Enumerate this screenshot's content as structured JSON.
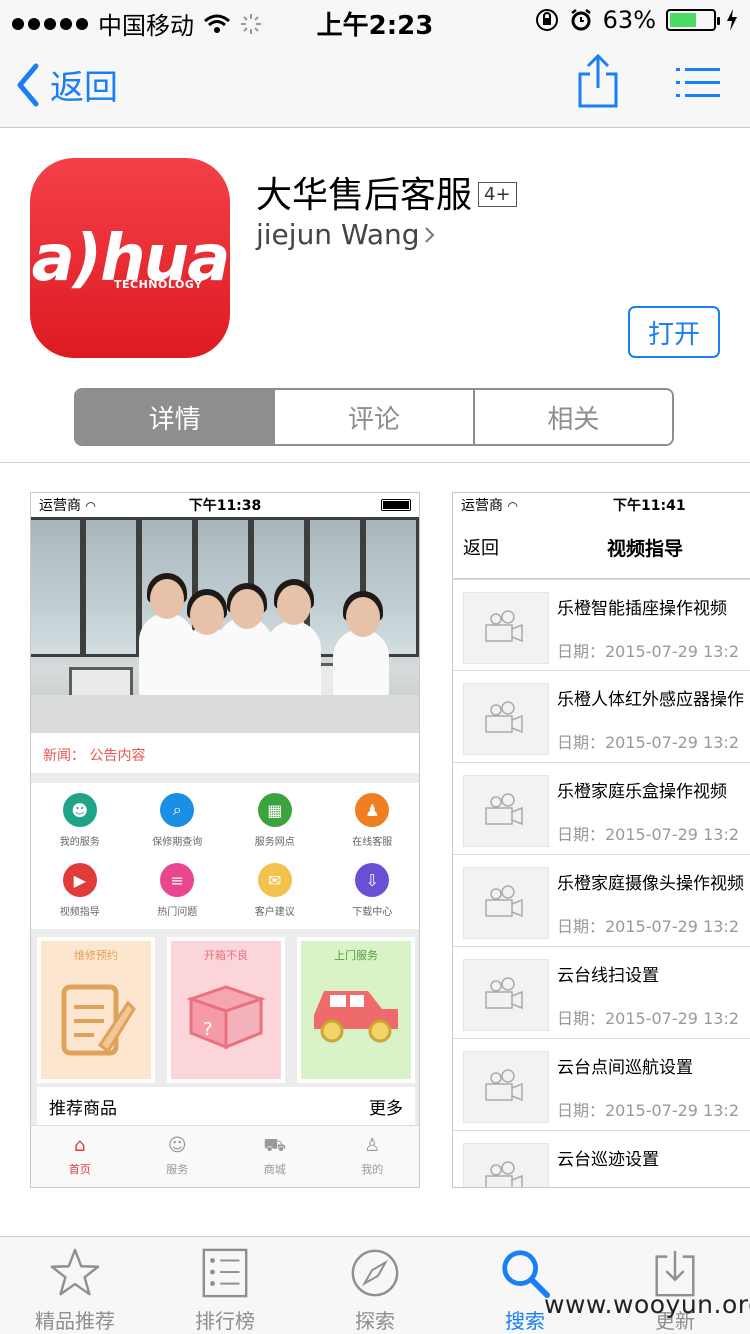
{
  "status_bar": {
    "carrier": "中国移动",
    "time": "上午2:23",
    "battery_percent": "63%",
    "battery_level": 0.63
  },
  "nav": {
    "back_label": "返回",
    "icons": [
      "share-icon",
      "list-icon"
    ]
  },
  "app": {
    "icon_logo": "a)hua",
    "icon_subtext": "TECHNOLOGY",
    "name": "大华售后客服",
    "age_rating": "4+",
    "developer": "jiejun Wang",
    "open_label": "打开"
  },
  "segments": [
    {
      "label": "详情",
      "active": true
    },
    {
      "label": "评论",
      "active": false
    },
    {
      "label": "相关",
      "active": false
    }
  ],
  "screenshot1": {
    "status": {
      "carrier": "运营商",
      "time": "下午11:38"
    },
    "news": "新闻：  公告内容",
    "grid": [
      {
        "label": "我的服务",
        "color": "#1fa389",
        "icon": "people-icon"
      },
      {
        "label": "保修期查询",
        "color": "#1a8fe3",
        "icon": "search-icon"
      },
      {
        "label": "服务网点",
        "color": "#3da33d",
        "icon": "map-icon"
      },
      {
        "label": "在线客服",
        "color": "#f07e22",
        "icon": "person-icon"
      },
      {
        "label": "视频指导",
        "color": "#e03a3a",
        "icon": "video-icon"
      },
      {
        "label": "热门问题",
        "color": "#e8478e",
        "icon": "list-icon"
      },
      {
        "label": "客户建议",
        "color": "#f2c14e",
        "icon": "chat-icon"
      },
      {
        "label": "下载中心",
        "color": "#6b4fd3",
        "icon": "download-icon"
      }
    ],
    "cards": [
      {
        "label": "维修预约",
        "bg": "#fde6cf",
        "color": "#e0a15a"
      },
      {
        "label": "开箱不良",
        "bg": "#fbd5da",
        "color": "#e8727f"
      },
      {
        "label": "上门服务",
        "bg": "#d9f2c8",
        "color": "#5a9a3c"
      }
    ],
    "recommend_label": "推荐商品",
    "more_label": "更多",
    "tabs": [
      {
        "label": "首页",
        "active": true
      },
      {
        "label": "服务",
        "active": false
      },
      {
        "label": "商城",
        "active": false
      },
      {
        "label": "我的",
        "active": false
      }
    ]
  },
  "screenshot2": {
    "status": {
      "carrier": "运营商",
      "time": "下午11:41"
    },
    "back_label": "返回",
    "title": "视频指导",
    "items": [
      {
        "title": "乐橙智能插座操作视频",
        "date": "日期：2015-07-29 13:2"
      },
      {
        "title": "乐橙人体红外感应器操作",
        "date": "日期：2015-07-29 13:2"
      },
      {
        "title": "乐橙家庭乐盒操作视频",
        "date": "日期：2015-07-29 13:2"
      },
      {
        "title": "乐橙家庭摄像头操作视频",
        "date": "日期：2015-07-29 13:2"
      },
      {
        "title": "云台线扫设置",
        "date": "日期：2015-07-29 13:2"
      },
      {
        "title": "云台点间巡航设置",
        "date": "日期：2015-07-29 13:2"
      },
      {
        "title": "云台巡迹设置",
        "date": ""
      }
    ]
  },
  "tabbar": [
    {
      "label": "精品推荐",
      "icon": "star-icon",
      "active": false
    },
    {
      "label": "排行榜",
      "icon": "ranking-icon",
      "active": false
    },
    {
      "label": "探索",
      "icon": "compass-icon",
      "active": false
    },
    {
      "label": "搜索",
      "icon": "search-icon",
      "active": true
    },
    {
      "label": "更新",
      "icon": "update-icon",
      "active": false
    }
  ],
  "watermark": "www.wooyun.org",
  "colors": {
    "accent": "#1a7ef6",
    "brand_red": "#e52129"
  }
}
